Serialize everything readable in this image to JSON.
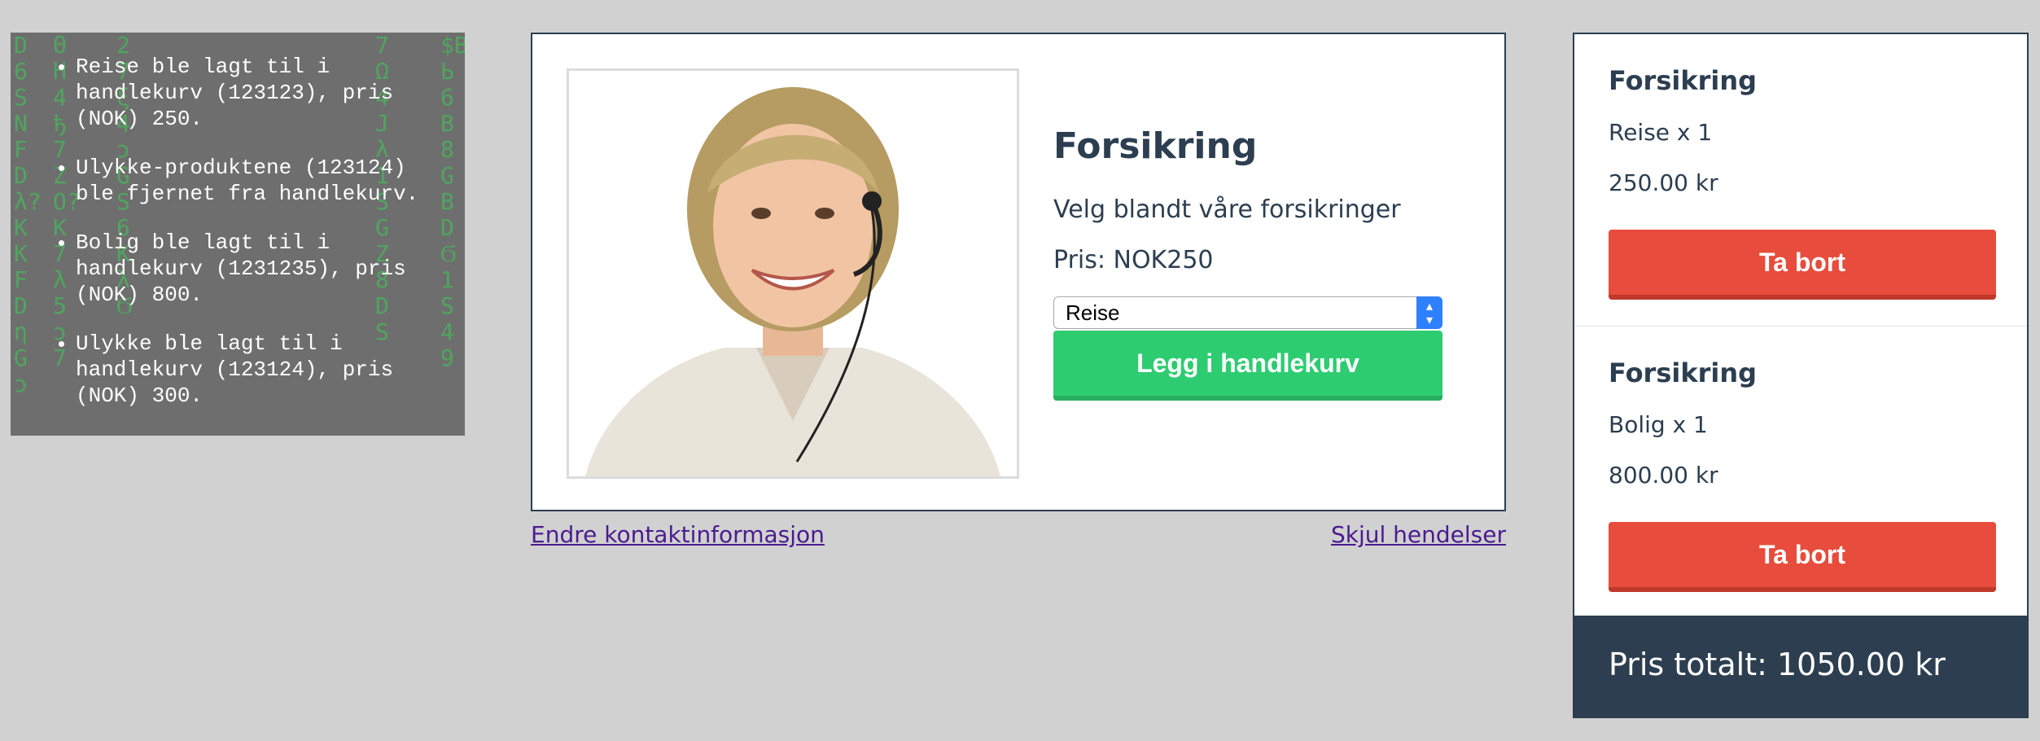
{
  "events": {
    "items": [
      "Reise ble lagt til i handlekurv (123123), pris (NOK) 250.",
      "Ulykke-produktene (123124) ble fjernet fra handlekurv.",
      "Bolig ble lagt til i handlekurv (1231235), pris (NOK) 800.",
      "Ulykke ble lagt til i handlekurv (123124), pris (NOK) 300."
    ]
  },
  "product": {
    "title": "Forsikring",
    "description": "Velg blandt våre forsikringer",
    "price": "Pris: NOK250",
    "select_value": "Reise",
    "add_button": "Legg i handlekurv"
  },
  "links": {
    "contact": "Endre kontaktinformasjon",
    "hide_events": "Skjul hendelser"
  },
  "cart": {
    "items": [
      {
        "title": "Forsikring",
        "qty": "Reise x 1",
        "price": "250.00 kr",
        "remove": "Ta bort"
      },
      {
        "title": "Forsikring",
        "qty": "Bolig x 1",
        "price": "800.00 kr",
        "remove": "Ta bort"
      }
    ],
    "total": "Pris totalt: 1050.00 kr"
  },
  "colors": {
    "accent_green": "#2ecc71",
    "accent_red": "#e74c3c",
    "navy": "#2c3e50",
    "link": "#4b1c8f"
  }
}
